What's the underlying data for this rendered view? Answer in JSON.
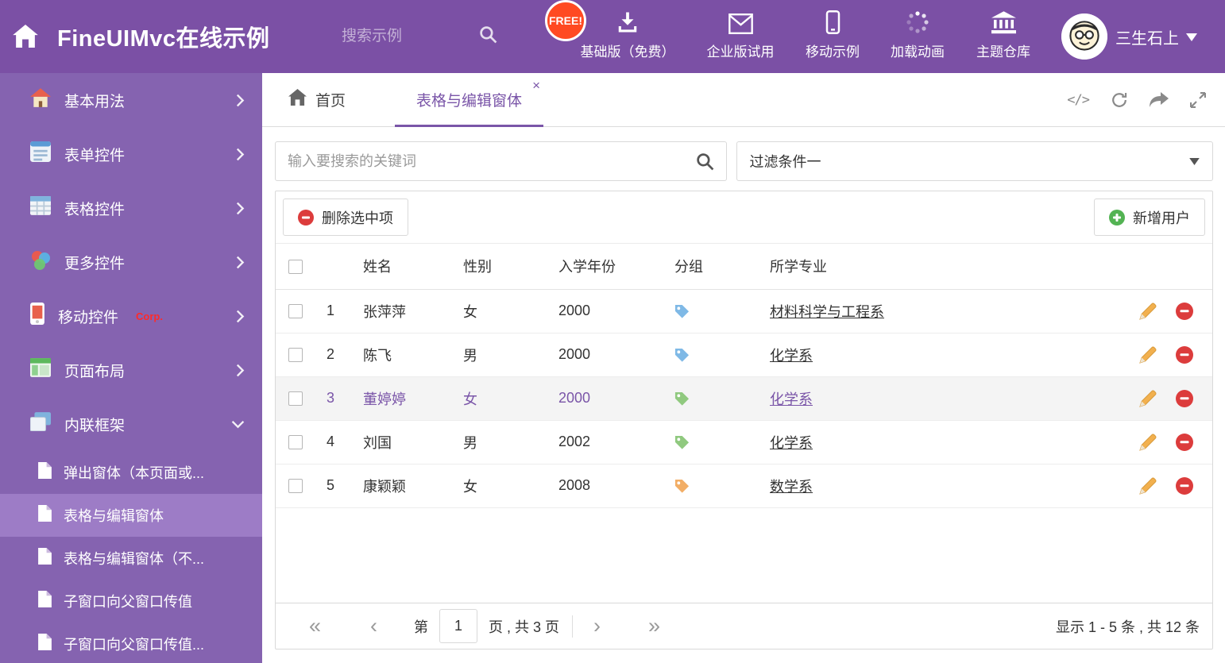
{
  "colors": {
    "header-bg": "#7b50a5",
    "sidebar-bg": "#8563b0",
    "sidebar-active": "#9d7cc6",
    "accent": "#7a55a8",
    "badge-red": "#ff4a22",
    "corp-red": "#ff2a2a",
    "delete-red": "#dc3c3c",
    "add-green": "#53b353",
    "row-selected-bg": "#f4f4f4"
  },
  "header": {
    "title": "FineUIMvc在线示例",
    "search_placeholder": "搜索示例",
    "free_badge": "FREE!",
    "nav": [
      {
        "icon": "download-icon",
        "label": "基础版（免费）"
      },
      {
        "icon": "envelope-icon",
        "label": "企业版试用"
      },
      {
        "icon": "mobile-icon",
        "label": "移动示例"
      },
      {
        "icon": "spinner-icon",
        "label": "加载动画"
      },
      {
        "icon": "bank-icon",
        "label": "主题仓库"
      }
    ],
    "user_name": "三生石上"
  },
  "sidebar": {
    "items": [
      {
        "icon": "home-icon",
        "label": "基本用法"
      },
      {
        "icon": "form-icon",
        "label": "表单控件"
      },
      {
        "icon": "table-icon",
        "label": "表格控件"
      },
      {
        "icon": "more-icon",
        "label": "更多控件"
      },
      {
        "icon": "mobile-icon",
        "label": "移动控件",
        "badge": "Corp."
      },
      {
        "icon": "layout-icon",
        "label": "页面布局"
      },
      {
        "icon": "iframe-icon",
        "label": "内联框架",
        "expanded": true
      }
    ],
    "subitems": [
      {
        "label": "弹出窗体（本页面或...",
        "active": false
      },
      {
        "label": "表格与编辑窗体",
        "active": true
      },
      {
        "label": "表格与编辑窗体（不...",
        "active": false
      },
      {
        "label": "子窗口向父窗口传值",
        "active": false
      },
      {
        "label": "子窗口向父窗口传值...",
        "active": false
      }
    ]
  },
  "tabs": {
    "home_label": "首页",
    "active_label": "表格与编辑窗体"
  },
  "filters": {
    "search_placeholder": "输入要搜索的关键词",
    "selected_filter": "过滤条件一"
  },
  "toolbar": {
    "delete_label": "删除选中项",
    "add_label": "新增用户"
  },
  "table": {
    "headers": [
      "姓名",
      "性别",
      "入学年份",
      "分组",
      "所学专业"
    ],
    "rows": [
      {
        "num": "1",
        "name": "张萍萍",
        "gender": "女",
        "year": "2000",
        "tag_color": "#7fb9e6",
        "major": "材料科学与工程系",
        "selected": false
      },
      {
        "num": "2",
        "name": "陈飞",
        "gender": "男",
        "year": "2000",
        "tag_color": "#7fb9e6",
        "major": "化学系",
        "selected": false
      },
      {
        "num": "3",
        "name": "董婷婷",
        "gender": "女",
        "year": "2000",
        "tag_color": "#90c97f",
        "major": "化学系",
        "selected": true
      },
      {
        "num": "4",
        "name": "刘国",
        "gender": "男",
        "year": "2002",
        "tag_color": "#90c97f",
        "major": "化学系",
        "selected": false
      },
      {
        "num": "5",
        "name": "康颖颖",
        "gender": "女",
        "year": "2008",
        "tag_color": "#f2ae66",
        "major": "数学系",
        "selected": false
      }
    ]
  },
  "pagination": {
    "prefix": "第",
    "page": "1",
    "suffix": "页 , 共 3 页",
    "summary": "显示 1 - 5 条 , 共 12 条"
  }
}
